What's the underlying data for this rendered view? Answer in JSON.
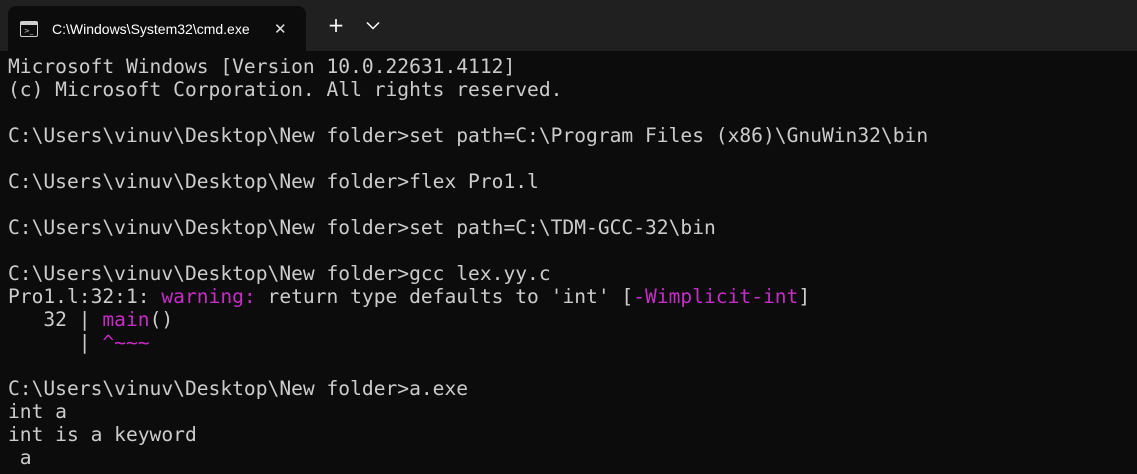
{
  "window": {
    "tab_title": "C:\\Windows\\System32\\cmd.exe",
    "tab_icon": "terminal-icon",
    "close_glyph": "✕",
    "new_tab_glyph": "+",
    "dropdown_icon": "chevron-down-icon"
  },
  "colors": {
    "background": "#0c0c0c",
    "titlebar": "#202020",
    "text": "#cccccc",
    "warning": "#c62dc6"
  },
  "terminal": {
    "lines": [
      "Microsoft Windows [Version 10.0.22631.4112]",
      "(c) Microsoft Corporation. All rights reserved.",
      "",
      "C:\\Users\\vinuv\\Desktop\\New folder>set path=C:\\Program Files (x86)\\GnuWin32\\bin",
      "",
      "C:\\Users\\vinuv\\Desktop\\New folder>flex Pro1.l",
      "",
      "C:\\Users\\vinuv\\Desktop\\New folder>set path=C:\\TDM-GCC-32\\bin",
      "",
      "C:\\Users\\vinuv\\Desktop\\New folder>gcc lex.yy.c"
    ],
    "warning": {
      "location": "Pro1.l:32:1: ",
      "label": "warning:",
      "message": " return type defaults to 'int' [",
      "flag": "-Wimplicit-int",
      "close": "]"
    },
    "snippet": {
      "prefix": "   32 | ",
      "code": "main",
      "suffix": "()",
      "marker_prefix": "      | ",
      "marker": "^~~~"
    },
    "after_lines": [
      "",
      "C:\\Users\\vinuv\\Desktop\\New folder>a.exe",
      "int a",
      "int is a keyword",
      " a"
    ]
  }
}
